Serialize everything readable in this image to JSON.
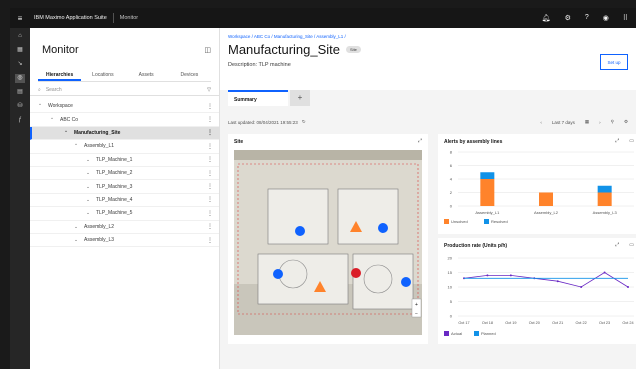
{
  "topbar": {
    "brand": "IBM Maximo Application Suite",
    "section": "Monitor"
  },
  "left_panel": {
    "title": "Monitor",
    "tabs": [
      "Hierarchies",
      "Locations",
      "Assets",
      "Devices"
    ],
    "search_placeholder": "Search",
    "tree": [
      {
        "label": "Workspace",
        "level": 0,
        "chevron": "up"
      },
      {
        "label": "ABC Co",
        "level": 1,
        "chevron": "up"
      },
      {
        "label": "Manufacturing_Site",
        "level": 2,
        "chevron": "up",
        "selected": true
      },
      {
        "label": "Assembly_L1",
        "level": 3,
        "chevron": "up"
      },
      {
        "label": "TLP_Machine_1",
        "level": 4,
        "chevron": "down"
      },
      {
        "label": "TLP_Machine_2",
        "level": 4,
        "chevron": "down"
      },
      {
        "label": "TLP_Machine_3",
        "level": 4,
        "chevron": "down"
      },
      {
        "label": "TLP_Machine_4",
        "level": 4,
        "chevron": "down"
      },
      {
        "label": "TLP_Machine_5",
        "level": 4,
        "chevron": "down"
      },
      {
        "label": "Assembly_L2",
        "level": 3,
        "chevron": "down"
      },
      {
        "label": "Assembly_L3",
        "level": 3,
        "chevron": "down"
      }
    ]
  },
  "main": {
    "breadcrumb": "Workspace / ABC Co / Manufacturing_Site / Assembly_L1 /",
    "title": "Manufacturing_Site",
    "title_badge": "Site",
    "description": "Description: TLP machine",
    "setup_button": "Set up",
    "tab": "Summary",
    "last_updated": "Last updated: 08/04/2021 19:55:23",
    "date_range": "Last 7 days"
  },
  "cards": {
    "site_title": "Site",
    "alerts_title": "Alerts by assembly lines",
    "production_title": "Production rate (Units p/h)"
  },
  "chart_data": [
    {
      "type": "bar",
      "title": "Alerts by assembly lines",
      "categories": [
        "Assembly_L1",
        "Assembly_L2",
        "Assembly_L3"
      ],
      "series": [
        {
          "name": "Unsolved",
          "color": "#ff832b",
          "values": [
            4,
            2,
            2
          ]
        },
        {
          "name": "Resolved",
          "color": "#1192e8",
          "values": [
            1,
            0,
            1
          ]
        }
      ],
      "ylim": [
        0,
        8
      ],
      "yticks": [
        0,
        2,
        4,
        6,
        8
      ]
    },
    {
      "type": "line",
      "title": "Production rate (Units p/h)",
      "x": [
        "Oct 17",
        "Oct 18",
        "Oct 19",
        "Oct 20",
        "Oct 21",
        "Oct 22",
        "Oct 23",
        "Oct 24"
      ],
      "series": [
        {
          "name": "Actual",
          "color": "#6929c4",
          "values": [
            13,
            14,
            14,
            13,
            12,
            10,
            15,
            10
          ]
        },
        {
          "name": "Planned",
          "color": "#1192e8",
          "values": [
            13,
            13,
            13,
            13,
            13,
            13,
            13,
            13
          ]
        }
      ],
      "ylim": [
        0,
        20
      ],
      "yticks": [
        0,
        5,
        10,
        15,
        20
      ]
    }
  ]
}
